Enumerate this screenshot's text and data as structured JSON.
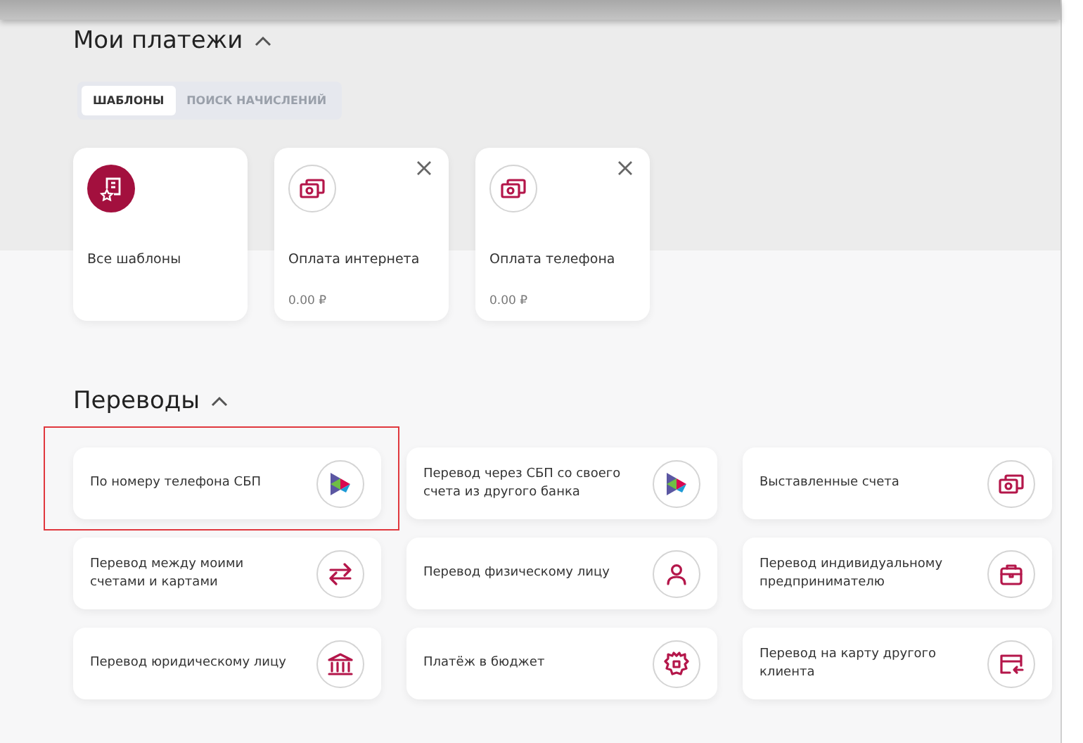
{
  "payments": {
    "title": "Мои платежи",
    "expanded": true,
    "tabs": [
      {
        "label": "ШАБЛОНЫ",
        "selected": true
      },
      {
        "label": "ПОИСК НАЧИСЛЕНИЙ",
        "selected": false
      }
    ],
    "templates": [
      {
        "kind": "all",
        "name": "Все шаблоны"
      },
      {
        "kind": "template",
        "name": "Оплата интернета",
        "amount": "0.00 ₽"
      },
      {
        "kind": "template",
        "name": "Оплата телефона",
        "amount": "0.00 ₽"
      }
    ]
  },
  "transfers": {
    "title": "Переводы",
    "expanded": true,
    "items": [
      {
        "label": "По номеру телефона СБП",
        "kind": "sbp",
        "highlighted": true
      },
      {
        "label": "Перевод через СБП со своего счета из другого банка",
        "kind": "sbp",
        "highlighted": false
      },
      {
        "label": "Выставленные счета",
        "kind": "bills",
        "highlighted": false
      },
      {
        "label": "Перевод между моими счетами и картами",
        "kind": "arrows",
        "highlighted": false
      },
      {
        "label": "Перевод физическому лицу",
        "kind": "person",
        "highlighted": false
      },
      {
        "label": "Перевод индивидуальному предпринимателю",
        "kind": "briefcase",
        "highlighted": false
      },
      {
        "label": "Перевод юридическому лицу",
        "kind": "bank",
        "highlighted": false
      },
      {
        "label": "Платёж в бюджет",
        "kind": "emblem",
        "highlighted": false
      },
      {
        "label": "Перевод на карту другого клиента",
        "kind": "card",
        "highlighted": false
      }
    ]
  }
}
